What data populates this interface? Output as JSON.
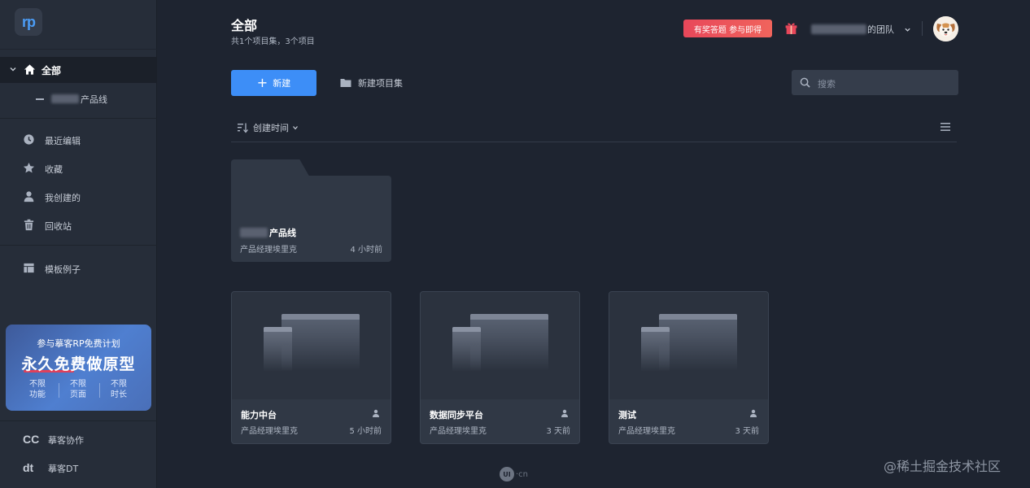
{
  "brand": {
    "logo_text": "rp",
    "accent": "#3d8ef7"
  },
  "sidebar": {
    "all_label": "全部",
    "subitem_suffix": "产品线",
    "items": [
      {
        "label": "最近编辑",
        "icon": "clock-icon"
      },
      {
        "label": "收藏",
        "icon": "star-icon"
      },
      {
        "label": "我创建的",
        "icon": "user-icon"
      },
      {
        "label": "回收站",
        "icon": "trash-icon"
      }
    ],
    "template_label": "模板例子",
    "promo": {
      "top": "参与摹客RP免费计划",
      "headline": "永久免费做原型",
      "features": [
        {
          "line1": "不限",
          "line2": "功能"
        },
        {
          "line1": "不限",
          "line2": "页面"
        },
        {
          "line1": "不限",
          "line2": "时长"
        }
      ]
    },
    "bottom": [
      {
        "label": "摹客协作",
        "icon_text": "CC"
      },
      {
        "label": "摹客DT",
        "icon_text": "dt"
      }
    ]
  },
  "header": {
    "title": "全部",
    "subtitle": "共1个项目集，3个项目",
    "badge": "有奖答题 参与即得",
    "team_suffix": "的团队"
  },
  "toolbar": {
    "new_label": "新建",
    "new_folder_label": "新建项目集",
    "search_placeholder": "搜索",
    "sort_label": "创建时间"
  },
  "folder": {
    "name_suffix": "产品线",
    "owner": "产品经理埃里克",
    "time": "4 小时前"
  },
  "projects": [
    {
      "name": "能力中台",
      "owner": "产品经理埃里克",
      "time": "5 小时前"
    },
    {
      "name": "数据同步平台",
      "owner": "产品经理埃里克",
      "time": "3 天前"
    },
    {
      "name": "测试",
      "owner": "产品经理埃里克",
      "time": "3 天前"
    }
  ],
  "watermarks": {
    "ui": "UI",
    "ui_suffix": "·cn",
    "juejin": "@稀土掘金技术社区"
  }
}
